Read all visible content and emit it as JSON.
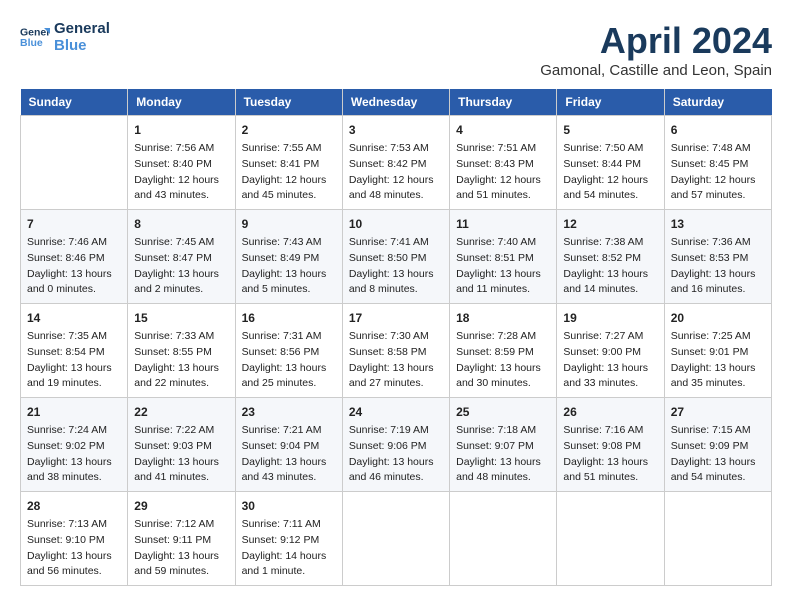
{
  "header": {
    "logo_line1": "General",
    "logo_line2": "Blue",
    "month_title": "April 2024",
    "location": "Gamonal, Castille and Leon, Spain"
  },
  "days_of_week": [
    "Sunday",
    "Monday",
    "Tuesday",
    "Wednesday",
    "Thursday",
    "Friday",
    "Saturday"
  ],
  "weeks": [
    [
      {
        "day": "",
        "sunrise": "",
        "sunset": "",
        "daylight": ""
      },
      {
        "day": "1",
        "sunrise": "Sunrise: 7:56 AM",
        "sunset": "Sunset: 8:40 PM",
        "daylight": "Daylight: 12 hours and 43 minutes."
      },
      {
        "day": "2",
        "sunrise": "Sunrise: 7:55 AM",
        "sunset": "Sunset: 8:41 PM",
        "daylight": "Daylight: 12 hours and 45 minutes."
      },
      {
        "day": "3",
        "sunrise": "Sunrise: 7:53 AM",
        "sunset": "Sunset: 8:42 PM",
        "daylight": "Daylight: 12 hours and 48 minutes."
      },
      {
        "day": "4",
        "sunrise": "Sunrise: 7:51 AM",
        "sunset": "Sunset: 8:43 PM",
        "daylight": "Daylight: 12 hours and 51 minutes."
      },
      {
        "day": "5",
        "sunrise": "Sunrise: 7:50 AM",
        "sunset": "Sunset: 8:44 PM",
        "daylight": "Daylight: 12 hours and 54 minutes."
      },
      {
        "day": "6",
        "sunrise": "Sunrise: 7:48 AM",
        "sunset": "Sunset: 8:45 PM",
        "daylight": "Daylight: 12 hours and 57 minutes."
      }
    ],
    [
      {
        "day": "7",
        "sunrise": "Sunrise: 7:46 AM",
        "sunset": "Sunset: 8:46 PM",
        "daylight": "Daylight: 13 hours and 0 minutes."
      },
      {
        "day": "8",
        "sunrise": "Sunrise: 7:45 AM",
        "sunset": "Sunset: 8:47 PM",
        "daylight": "Daylight: 13 hours and 2 minutes."
      },
      {
        "day": "9",
        "sunrise": "Sunrise: 7:43 AM",
        "sunset": "Sunset: 8:49 PM",
        "daylight": "Daylight: 13 hours and 5 minutes."
      },
      {
        "day": "10",
        "sunrise": "Sunrise: 7:41 AM",
        "sunset": "Sunset: 8:50 PM",
        "daylight": "Daylight: 13 hours and 8 minutes."
      },
      {
        "day": "11",
        "sunrise": "Sunrise: 7:40 AM",
        "sunset": "Sunset: 8:51 PM",
        "daylight": "Daylight: 13 hours and 11 minutes."
      },
      {
        "day": "12",
        "sunrise": "Sunrise: 7:38 AM",
        "sunset": "Sunset: 8:52 PM",
        "daylight": "Daylight: 13 hours and 14 minutes."
      },
      {
        "day": "13",
        "sunrise": "Sunrise: 7:36 AM",
        "sunset": "Sunset: 8:53 PM",
        "daylight": "Daylight: 13 hours and 16 minutes."
      }
    ],
    [
      {
        "day": "14",
        "sunrise": "Sunrise: 7:35 AM",
        "sunset": "Sunset: 8:54 PM",
        "daylight": "Daylight: 13 hours and 19 minutes."
      },
      {
        "day": "15",
        "sunrise": "Sunrise: 7:33 AM",
        "sunset": "Sunset: 8:55 PM",
        "daylight": "Daylight: 13 hours and 22 minutes."
      },
      {
        "day": "16",
        "sunrise": "Sunrise: 7:31 AM",
        "sunset": "Sunset: 8:56 PM",
        "daylight": "Daylight: 13 hours and 25 minutes."
      },
      {
        "day": "17",
        "sunrise": "Sunrise: 7:30 AM",
        "sunset": "Sunset: 8:58 PM",
        "daylight": "Daylight: 13 hours and 27 minutes."
      },
      {
        "day": "18",
        "sunrise": "Sunrise: 7:28 AM",
        "sunset": "Sunset: 8:59 PM",
        "daylight": "Daylight: 13 hours and 30 minutes."
      },
      {
        "day": "19",
        "sunrise": "Sunrise: 7:27 AM",
        "sunset": "Sunset: 9:00 PM",
        "daylight": "Daylight: 13 hours and 33 minutes."
      },
      {
        "day": "20",
        "sunrise": "Sunrise: 7:25 AM",
        "sunset": "Sunset: 9:01 PM",
        "daylight": "Daylight: 13 hours and 35 minutes."
      }
    ],
    [
      {
        "day": "21",
        "sunrise": "Sunrise: 7:24 AM",
        "sunset": "Sunset: 9:02 PM",
        "daylight": "Daylight: 13 hours and 38 minutes."
      },
      {
        "day": "22",
        "sunrise": "Sunrise: 7:22 AM",
        "sunset": "Sunset: 9:03 PM",
        "daylight": "Daylight: 13 hours and 41 minutes."
      },
      {
        "day": "23",
        "sunrise": "Sunrise: 7:21 AM",
        "sunset": "Sunset: 9:04 PM",
        "daylight": "Daylight: 13 hours and 43 minutes."
      },
      {
        "day": "24",
        "sunrise": "Sunrise: 7:19 AM",
        "sunset": "Sunset: 9:06 PM",
        "daylight": "Daylight: 13 hours and 46 minutes."
      },
      {
        "day": "25",
        "sunrise": "Sunrise: 7:18 AM",
        "sunset": "Sunset: 9:07 PM",
        "daylight": "Daylight: 13 hours and 48 minutes."
      },
      {
        "day": "26",
        "sunrise": "Sunrise: 7:16 AM",
        "sunset": "Sunset: 9:08 PM",
        "daylight": "Daylight: 13 hours and 51 minutes."
      },
      {
        "day": "27",
        "sunrise": "Sunrise: 7:15 AM",
        "sunset": "Sunset: 9:09 PM",
        "daylight": "Daylight: 13 hours and 54 minutes."
      }
    ],
    [
      {
        "day": "28",
        "sunrise": "Sunrise: 7:13 AM",
        "sunset": "Sunset: 9:10 PM",
        "daylight": "Daylight: 13 hours and 56 minutes."
      },
      {
        "day": "29",
        "sunrise": "Sunrise: 7:12 AM",
        "sunset": "Sunset: 9:11 PM",
        "daylight": "Daylight: 13 hours and 59 minutes."
      },
      {
        "day": "30",
        "sunrise": "Sunrise: 7:11 AM",
        "sunset": "Sunset: 9:12 PM",
        "daylight": "Daylight: 14 hours and 1 minute."
      },
      {
        "day": "",
        "sunrise": "",
        "sunset": "",
        "daylight": ""
      },
      {
        "day": "",
        "sunrise": "",
        "sunset": "",
        "daylight": ""
      },
      {
        "day": "",
        "sunrise": "",
        "sunset": "",
        "daylight": ""
      },
      {
        "day": "",
        "sunrise": "",
        "sunset": "",
        "daylight": ""
      }
    ]
  ]
}
